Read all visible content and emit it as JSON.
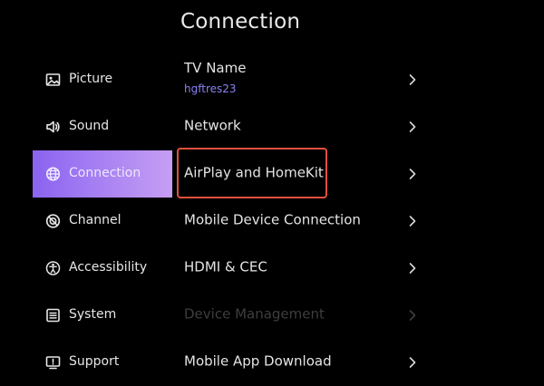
{
  "page": {
    "title": "Connection"
  },
  "sidebar": {
    "items": [
      {
        "label": "Picture",
        "icon": "picture-icon",
        "active": false
      },
      {
        "label": "Sound",
        "icon": "speaker-icon",
        "active": false
      },
      {
        "label": "Connection",
        "icon": "globe-icon",
        "active": true
      },
      {
        "label": "Channel",
        "icon": "channel-icon",
        "active": false
      },
      {
        "label": "Accessibility",
        "icon": "accessibility-icon",
        "active": false
      },
      {
        "label": "System",
        "icon": "system-icon",
        "active": false
      },
      {
        "label": "Support",
        "icon": "support-icon",
        "active": false
      }
    ]
  },
  "main": {
    "rows": [
      {
        "label": "TV Name",
        "value": "hgftres23",
        "enabled": true
      },
      {
        "label": "Network",
        "enabled": true
      },
      {
        "label": "AirPlay and HomeKit",
        "enabled": true,
        "highlighted": true
      },
      {
        "label": "Mobile Device Connection",
        "enabled": true
      },
      {
        "label": "HDMI & CEC",
        "enabled": true
      },
      {
        "label": "Device Management",
        "enabled": false
      },
      {
        "label": "Mobile App Download",
        "enabled": true
      }
    ]
  },
  "colors": {
    "background": "#000000",
    "active_gradient_start": "#8a63f0",
    "active_gradient_end": "#c69ef4",
    "value_text": "#8a82f2",
    "highlight_border": "#e1513f",
    "disabled_text": "#3e3e3e"
  }
}
